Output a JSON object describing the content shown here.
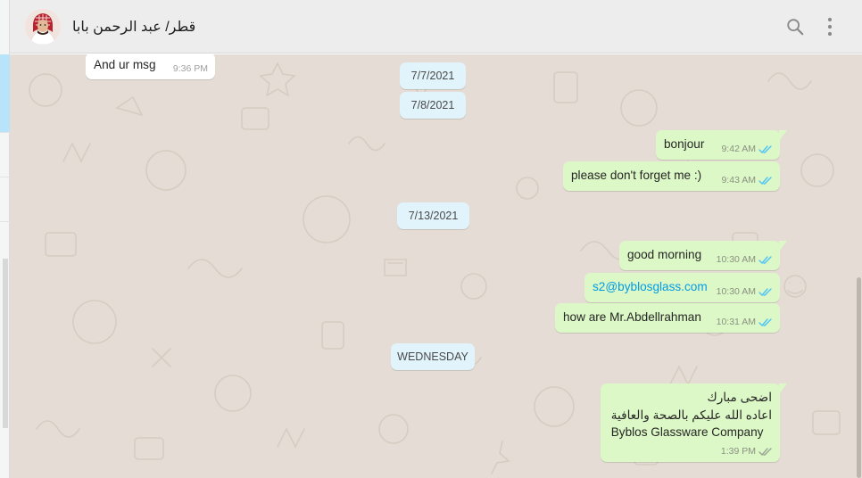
{
  "header": {
    "chat_name": "قطر/ عبد الرحمن بابا",
    "avatar_icon": "contact-avatar",
    "search_icon": "search-icon",
    "menu_icon": "kebab-menu-icon"
  },
  "colors": {
    "outgoing_bubble": "#dcf8c6",
    "incoming_bubble": "#ffffff",
    "date_chip": "#e1f3fb",
    "read_ticks": "#4fc3f7",
    "link": "#039be5",
    "wallpaper": "#e5ddd5"
  },
  "dates": [
    "7/7/2021",
    "7/8/2021",
    "7/13/2021",
    "WEDNESDAY"
  ],
  "messages": [
    {
      "direction": "in",
      "text": "And ur msg",
      "time": "9:36 PM"
    },
    {
      "direction": "out",
      "text": "bonjour",
      "time": "9:42 AM",
      "status": "read"
    },
    {
      "direction": "out",
      "text": "please don't forget me :)",
      "time": "9:43 AM",
      "status": "read"
    },
    {
      "direction": "out",
      "text": "good morning",
      "time": "10:30 AM",
      "status": "read"
    },
    {
      "direction": "out",
      "text": "s2@byblosglass.com",
      "time": "10:30 AM",
      "status": "read",
      "is_link": true
    },
    {
      "direction": "out",
      "text": "how are Mr.Abdellrahman",
      "time": "10:31 AM",
      "status": "read"
    },
    {
      "direction": "out",
      "lines": [
        "اضحى مبارك",
        "اعاده الله عليكم بالصحة والعافية",
        "Byblos Glassware Company"
      ],
      "time": "1:39 PM",
      "status": "sent"
    }
  ]
}
